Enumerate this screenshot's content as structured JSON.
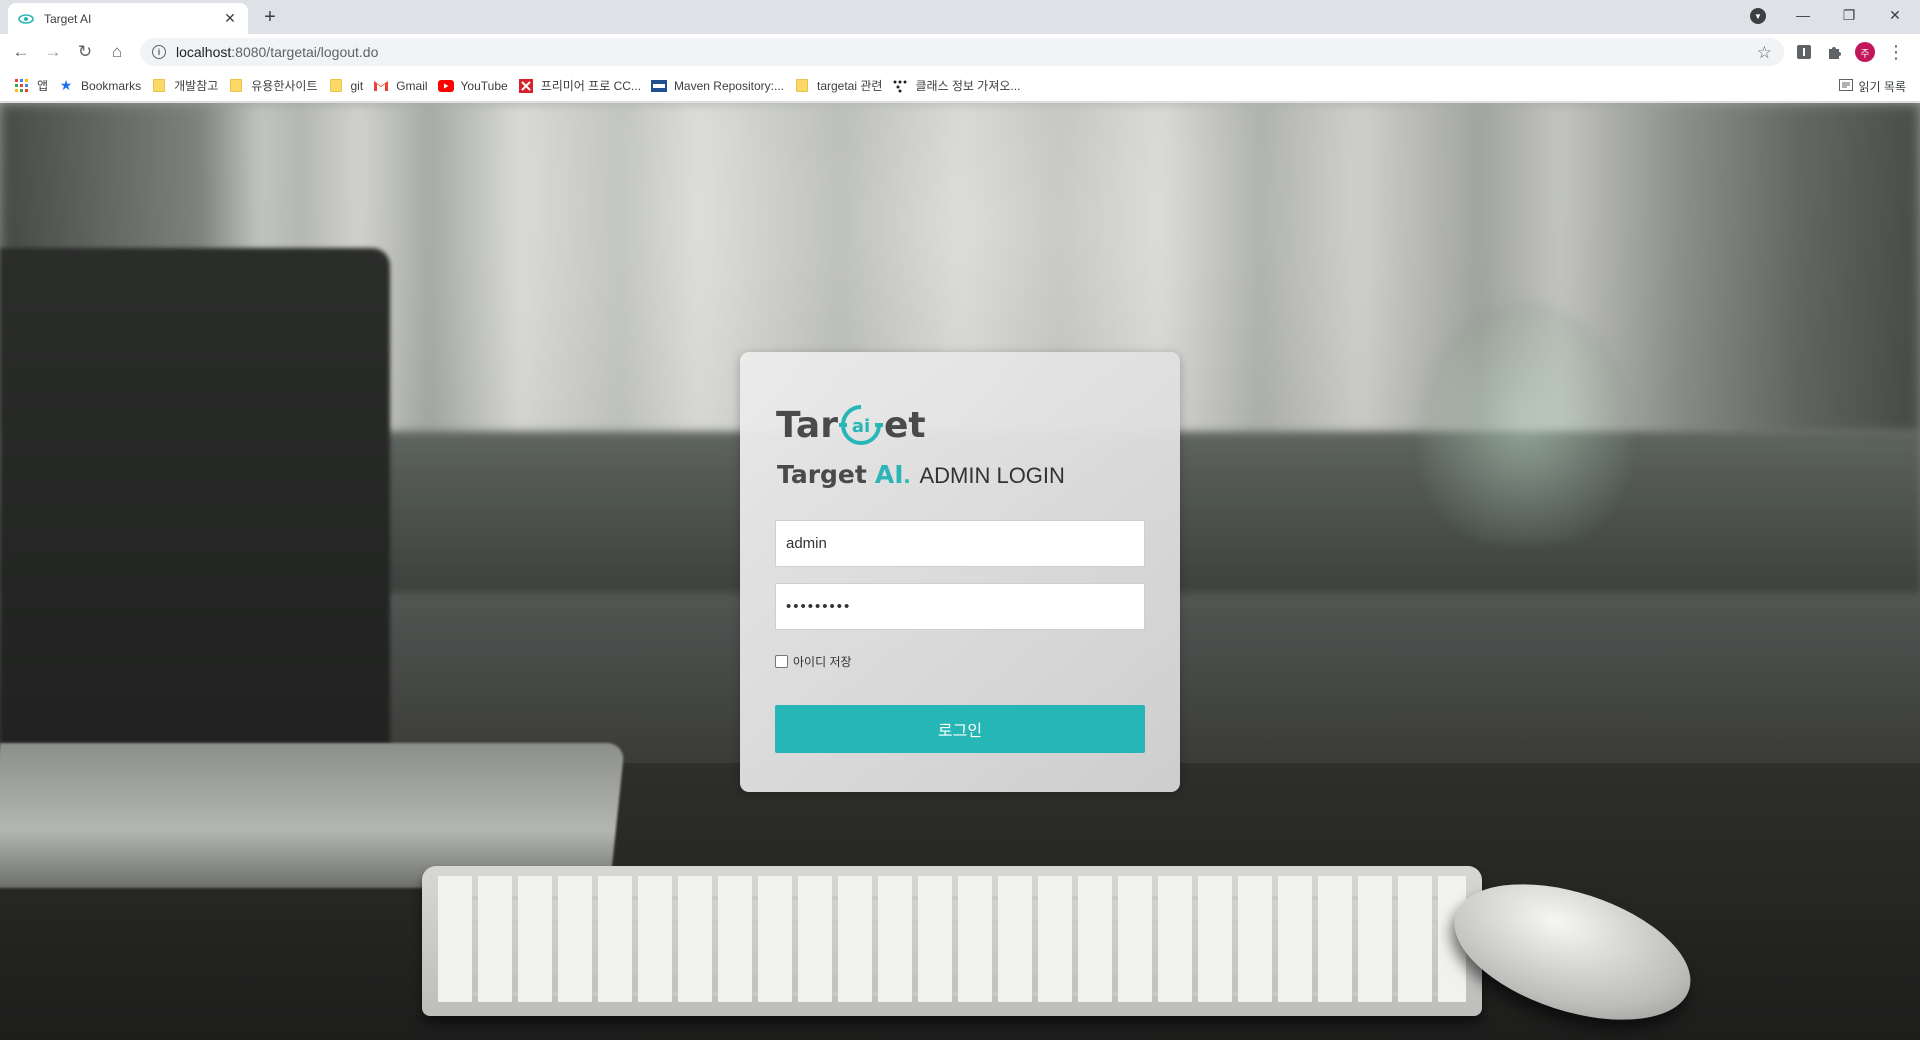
{
  "browser": {
    "tab": {
      "title": "Target AI",
      "favicon": "target-ai-favicon",
      "close_glyph": "✕"
    },
    "new_tab_glyph": "+",
    "window_controls": {
      "minimize": "—",
      "restore": "❐",
      "close": "✕"
    },
    "omnibox": {
      "url_host": "localhost",
      "url_path": ":8080/targetai/logout.do",
      "info_glyph": "i"
    },
    "nav_glyphs": {
      "back": "←",
      "forward": "→",
      "reload": "↻",
      "home": "⌂"
    },
    "profile_initial": "주",
    "bookmarks": [
      {
        "label": "앱",
        "icon": "apps-grid-icon"
      },
      {
        "label": "Bookmarks",
        "icon": "star-icon"
      },
      {
        "label": "개발참고",
        "icon": "folder-icon"
      },
      {
        "label": "유용한사이트",
        "icon": "folder-icon"
      },
      {
        "label": "git",
        "icon": "folder-icon"
      },
      {
        "label": "Gmail",
        "icon": "gmail-icon"
      },
      {
        "label": "YouTube",
        "icon": "youtube-icon"
      },
      {
        "label": "프리미어 프로 CC...",
        "icon": "dx-icon"
      },
      {
        "label": "Maven Repository:...",
        "icon": "maven-icon"
      },
      {
        "label": "targetai 관련",
        "icon": "folder-icon"
      },
      {
        "label": "클래스 정보 가져오...",
        "icon": "dots-icon"
      }
    ],
    "reading_list": "읽기 목록"
  },
  "login": {
    "logo_left": "Tar",
    "logo_right": "et",
    "logo_ai_letters": "ai",
    "heading_brand": "Target",
    "heading_ai": "AI",
    "heading_dot": ".",
    "heading_rest": "ADMIN LOGIN",
    "id_value": "admin",
    "password_value": "•••••••••",
    "remember_label": "아이디 저장",
    "submit_label": "로그인",
    "accent_color": "#27b6b6"
  }
}
